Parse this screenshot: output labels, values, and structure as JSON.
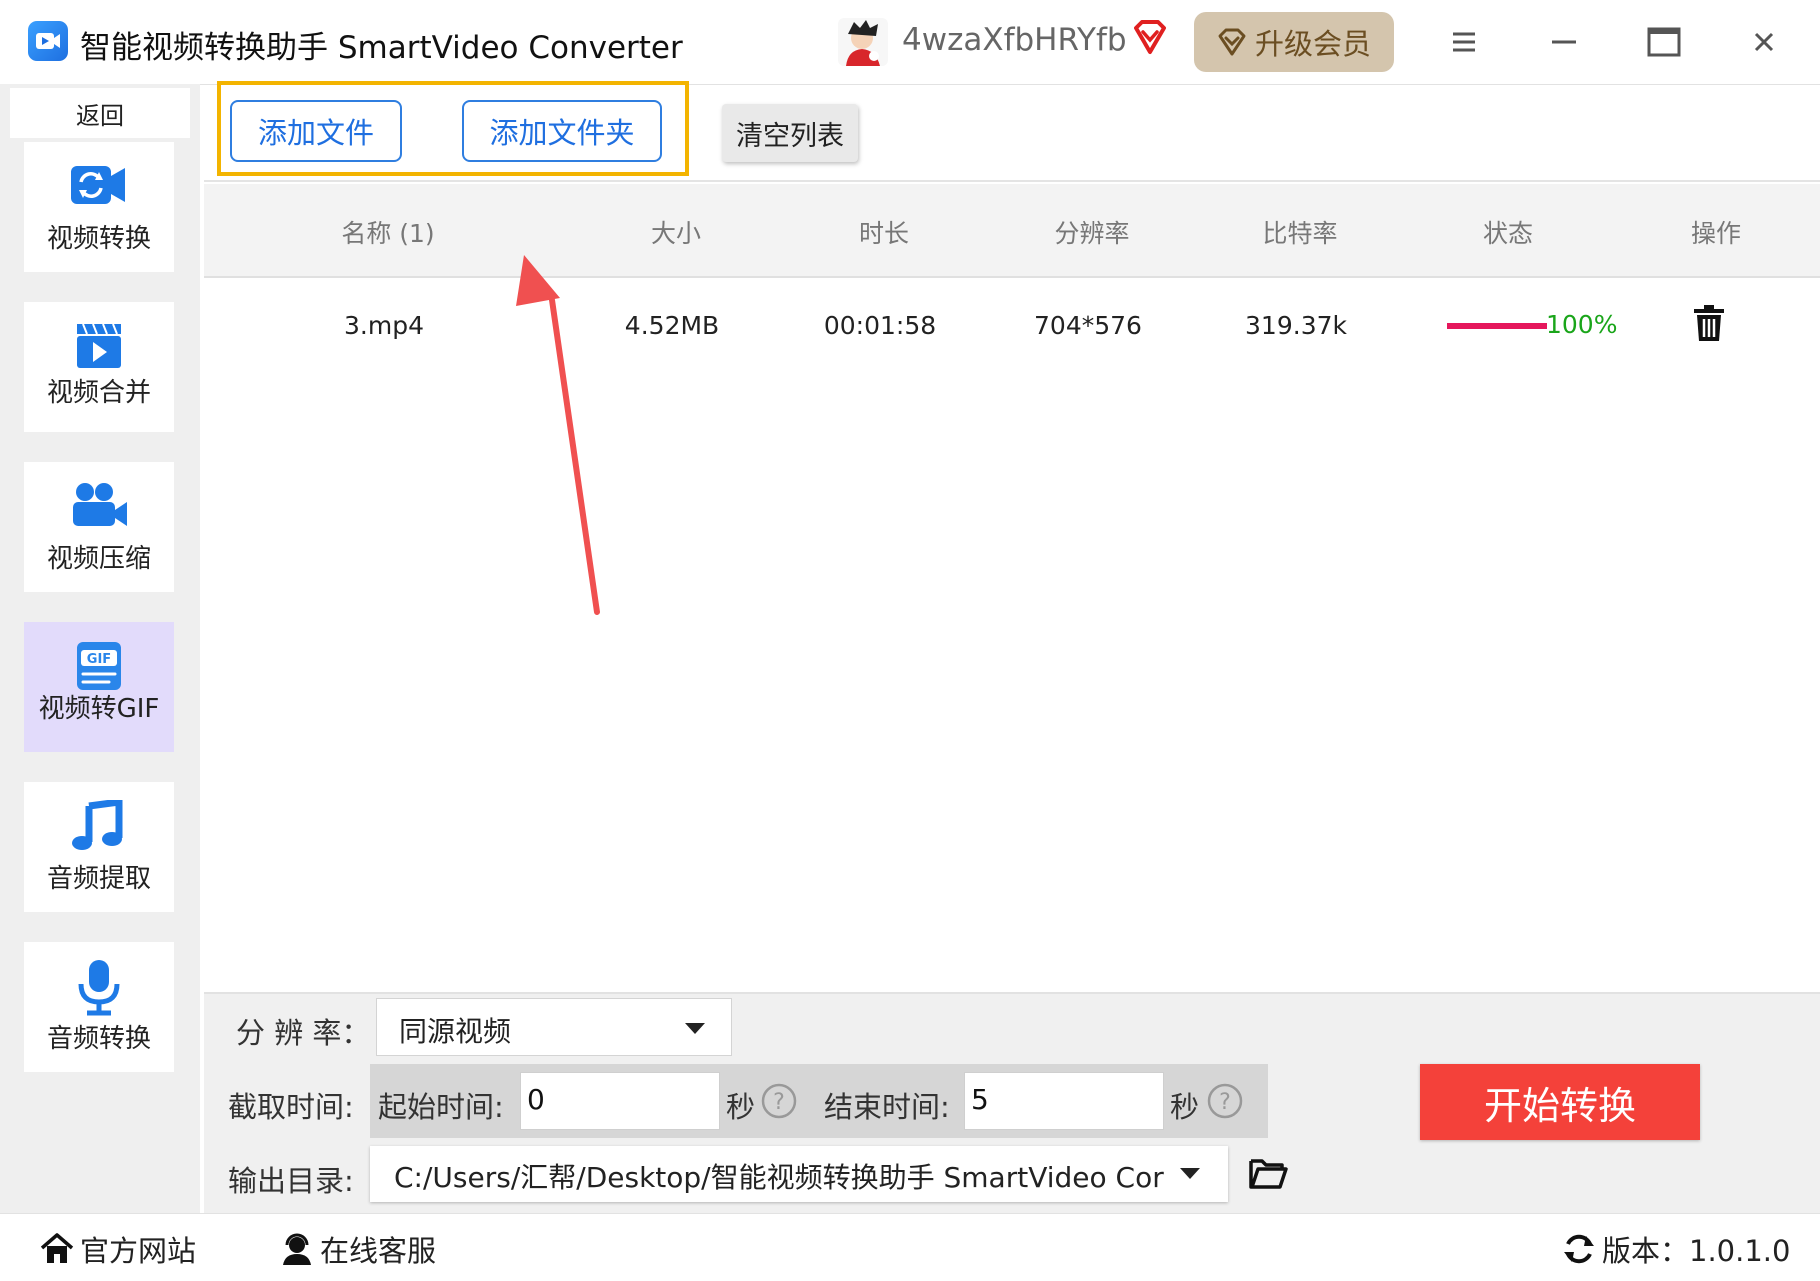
{
  "titlebar": {
    "app_title": "智能视频转换助手 SmartVideo Converter",
    "username": "4wzaXfbHRYfb",
    "upgrade_label": "升级会员"
  },
  "sidebar": {
    "back_label": "返回",
    "items": [
      {
        "label": "视频转换",
        "icon": "video-convert-icon"
      },
      {
        "label": "视频合并",
        "icon": "video-merge-icon"
      },
      {
        "label": "视频压缩",
        "icon": "video-compress-icon"
      },
      {
        "label": "视频转GIF",
        "icon": "gif-icon",
        "active": true
      },
      {
        "label": "音频提取",
        "icon": "music-note-icon"
      },
      {
        "label": "音频转换",
        "icon": "microphone-icon"
      }
    ]
  },
  "toolbar": {
    "add_file": "添加文件",
    "add_folder": "添加文件夹",
    "clear_list": "清空列表"
  },
  "table": {
    "headers": {
      "name": "名称 (1)",
      "size": "大小",
      "duration": "时长",
      "resolution": "分辨率",
      "bitrate": "比特率",
      "status": "状态",
      "action": "操作"
    },
    "rows": [
      {
        "name": "3.mp4",
        "size": "4.52MB",
        "duration": "00:01:58",
        "resolution": "704*576",
        "bitrate": "319.37k",
        "progress": 100,
        "progress_text": "100%"
      }
    ]
  },
  "settings": {
    "resolution_label": "分 辨 率：",
    "resolution_value": "同源视频",
    "clip_label": "截取时间:",
    "start_label": "起始时间:",
    "start_value": "0",
    "end_label": "结束时间:",
    "end_value": "5",
    "seconds_unit": "秒",
    "output_label": "输出目录:",
    "output_path": "C:/Users/汇帮/Desktop/智能视频转换助手 SmartVideo Cor",
    "start_button": "开始转换"
  },
  "footer": {
    "website": "官方网站",
    "support": "在线客服",
    "version": "版本：1.0.1.0"
  },
  "colors": {
    "accent_blue": "#1f6fe0",
    "highlight_yellow": "#f3b400",
    "start_red": "#f4413a",
    "progress_pink": "#e5175c",
    "progress_green": "#1aa51a",
    "arrow_red": "#f05050",
    "active_sidebar": "#e2dbfb"
  }
}
